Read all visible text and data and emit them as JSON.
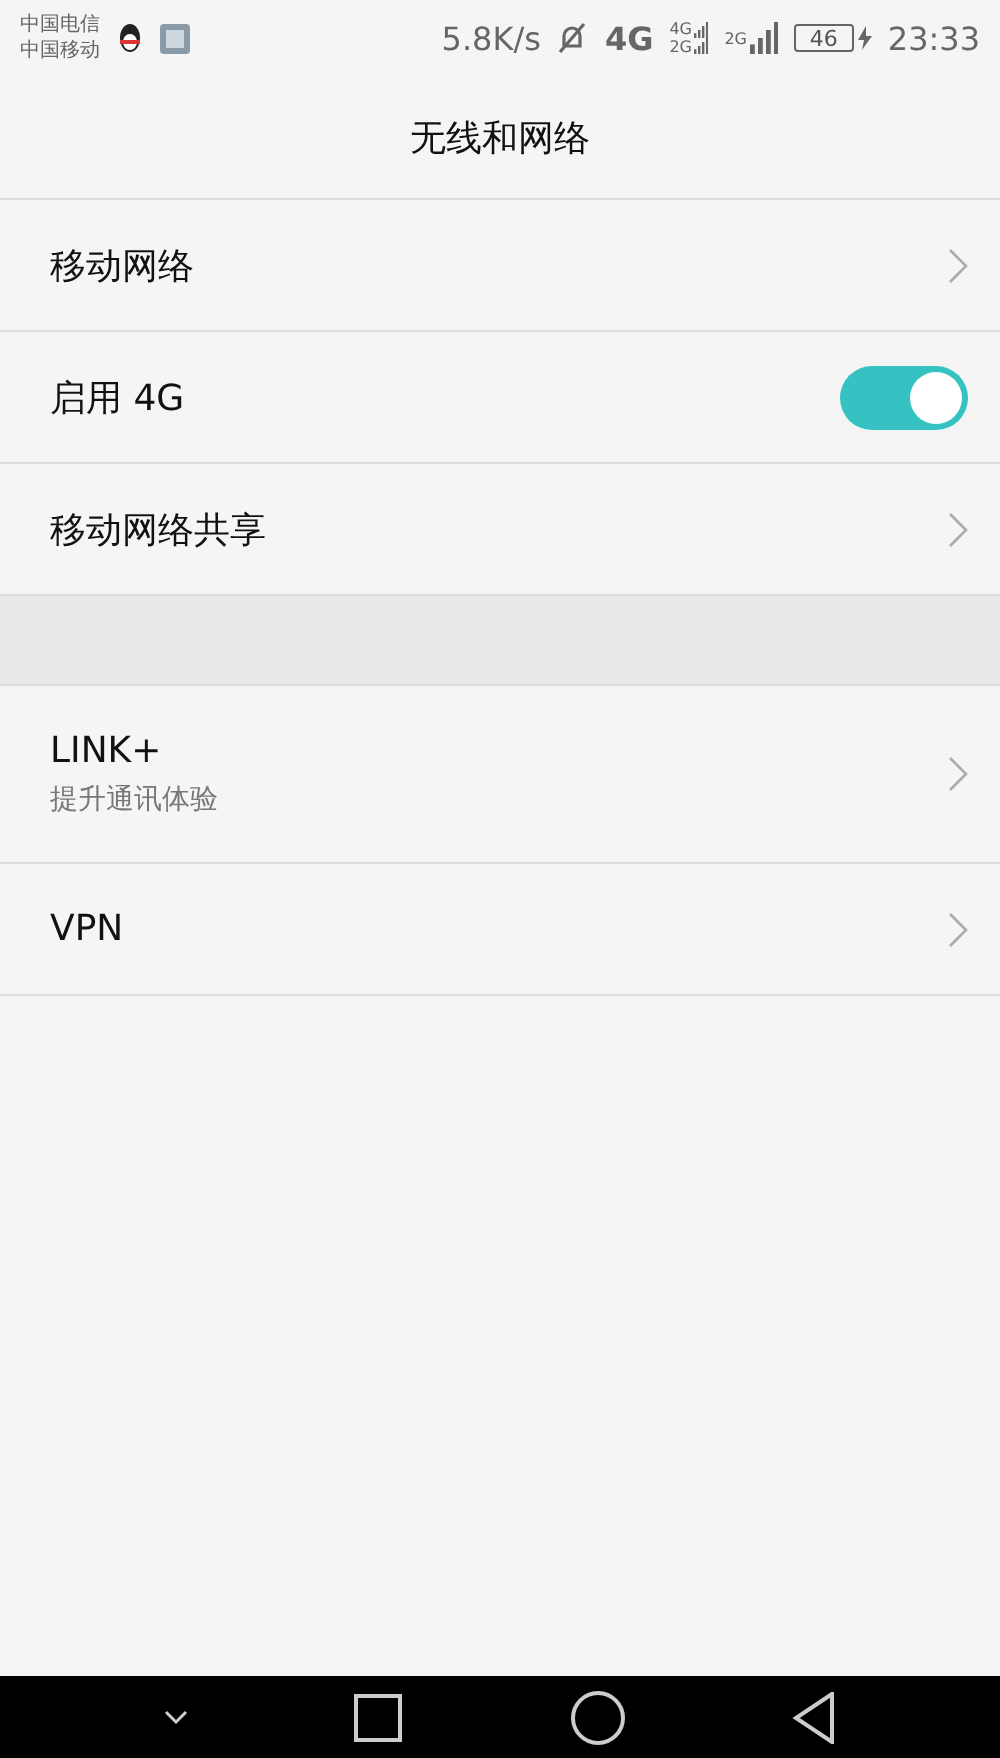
{
  "status_bar": {
    "carriers": [
      "中国电信",
      "中国移动"
    ],
    "speed": "5.8K/s",
    "network": "4G",
    "signals": [
      {
        "labels": [
          "4G",
          "2G"
        ]
      },
      {
        "labels": [
          "2G"
        ]
      }
    ],
    "battery": "46",
    "time": "23:33"
  },
  "title": "无线和网络",
  "groups": [
    {
      "items": [
        {
          "kind": "link",
          "label": "移动网络"
        },
        {
          "kind": "toggle",
          "label": "启用 4G",
          "on": true
        },
        {
          "kind": "link",
          "label": "移动网络共享"
        }
      ]
    },
    {
      "items": [
        {
          "kind": "link",
          "label": "LINK+",
          "subtitle": "提升通讯体验"
        },
        {
          "kind": "link",
          "label": "VPN"
        }
      ]
    }
  ]
}
